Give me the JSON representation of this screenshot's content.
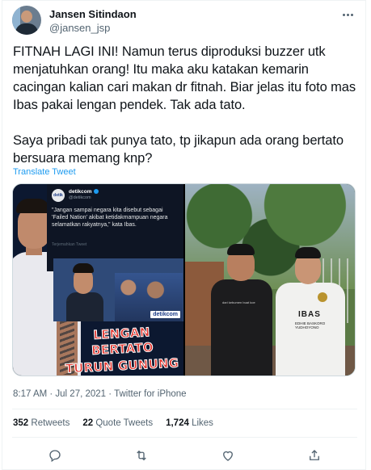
{
  "author": {
    "display_name": "Jansen Sitindaon",
    "handle": "@jansen_jsp"
  },
  "tweet": {
    "text": "FITNAH LAGI INI! Namun terus diproduksi buzzer utk menjatuhkan orang! Itu maka aku katakan kemarin cacingan kalian cari makan dr fitnah. Biar jelas itu foto mas Ibas pakai lengan pendek. Tak ada tato.\n\nSaya pribadi tak punya tato, tp jikapun ada orang bertato bersuara memang knp?",
    "translate_label": "Translate Tweet"
  },
  "media": {
    "left": {
      "post_avatar_text": "detik",
      "post_name": "detikcom",
      "post_handle": "@detikcom",
      "post_quote": "\"Jangan sampai negara kita disebut sebagai 'Failed Nation' akibat ketidakmampuan negara selamatkan rakyatnya,\" kata Ibas.",
      "post_translate": "Terjemahkan Tweet",
      "badge": "detikcom",
      "overlay_line1": "LENGAN BERTATO",
      "overlay_line2": "TURUN GUNUNG"
    },
    "right": {
      "shirt_text": "dari kebumen buat koe",
      "jersey_text": "IBAS",
      "jersey_sub": "EDHIE BASKORO YUDHOYONO"
    }
  },
  "meta": {
    "timestamp": "8:17 AM · Jul 27, 2021 · Twitter for iPhone"
  },
  "stats": {
    "retweets_count": "352",
    "retweets_label": "Retweets",
    "quotes_count": "22",
    "quotes_label": "Quote Tweets",
    "likes_count": "1,724",
    "likes_label": "Likes"
  },
  "colors": {
    "link": "#1d9bf0",
    "secondary_text": "#536471",
    "primary_text": "#0f1419",
    "overlay_red": "#e2342d"
  },
  "icons": [
    "more-icon",
    "reply-icon",
    "retweet-icon",
    "like-icon",
    "share-icon",
    "verified-icon"
  ]
}
